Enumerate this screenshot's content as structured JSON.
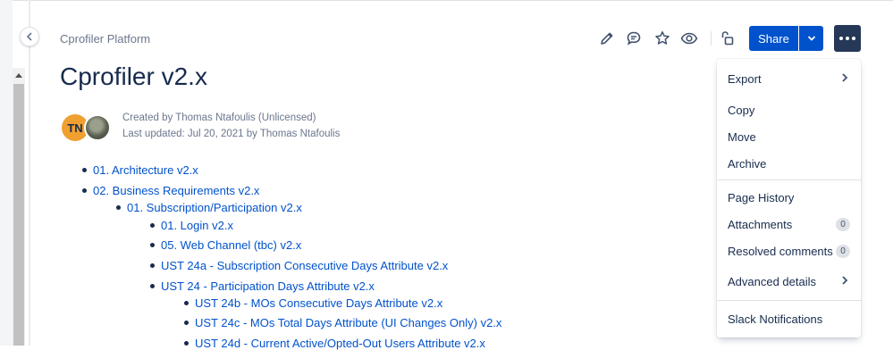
{
  "breadcrumb": "Cprofiler Platform",
  "page_title": "Cprofiler v2.x",
  "byline": {
    "created": "Created by Thomas Ntafoulis (Unlicensed)",
    "updated": "Last updated: Jul 20, 2021 by Thomas Ntafoulis",
    "avatar_initials": "TN"
  },
  "header": {
    "share_label": "Share",
    "icons": [
      "edit-icon",
      "comment-icon",
      "star-icon",
      "watch-icon",
      "restrictions-icon"
    ]
  },
  "tree": [
    {
      "label": "01. Architecture v2.x",
      "level": 0
    },
    {
      "label": "02. Business Requirements v2.x",
      "level": 0
    },
    {
      "label": "01. Subscription/Participation v2.x",
      "level": 1
    },
    {
      "label": "01. Login v2.x",
      "level": 2
    },
    {
      "label": "05. Web Channel (tbc) v2.x",
      "level": 2
    },
    {
      "label": "UST 24a - Subscription Consecutive Days Attribute v2.x",
      "level": 2
    },
    {
      "label": "UST 24 - Participation Days Attribute v2.x",
      "level": 2
    },
    {
      "label": "UST 24b - MOs Consecutive Days Attribute v2.x",
      "level": 3
    },
    {
      "label": "UST 24c - MOs Total Days Attribute (UI Changes Only) v2.x",
      "level": 3
    },
    {
      "label": "UST 24d - Current Active/Opted-Out Users Attribute v2.x",
      "level": 3
    }
  ],
  "menu": {
    "export": "Export",
    "copy": "Copy",
    "move": "Move",
    "archive": "Archive",
    "page_history": "Page History",
    "attachments": "Attachments",
    "attachments_count": "0",
    "resolved_comments": "Resolved comments",
    "resolved_comments_count": "0",
    "advanced_details": "Advanced details",
    "slack_notifications": "Slack Notifications"
  },
  "colors": {
    "link": "#0052cc",
    "primary_button": "#0052cc",
    "more_button": "#253858",
    "avatar": "#f0a030"
  }
}
